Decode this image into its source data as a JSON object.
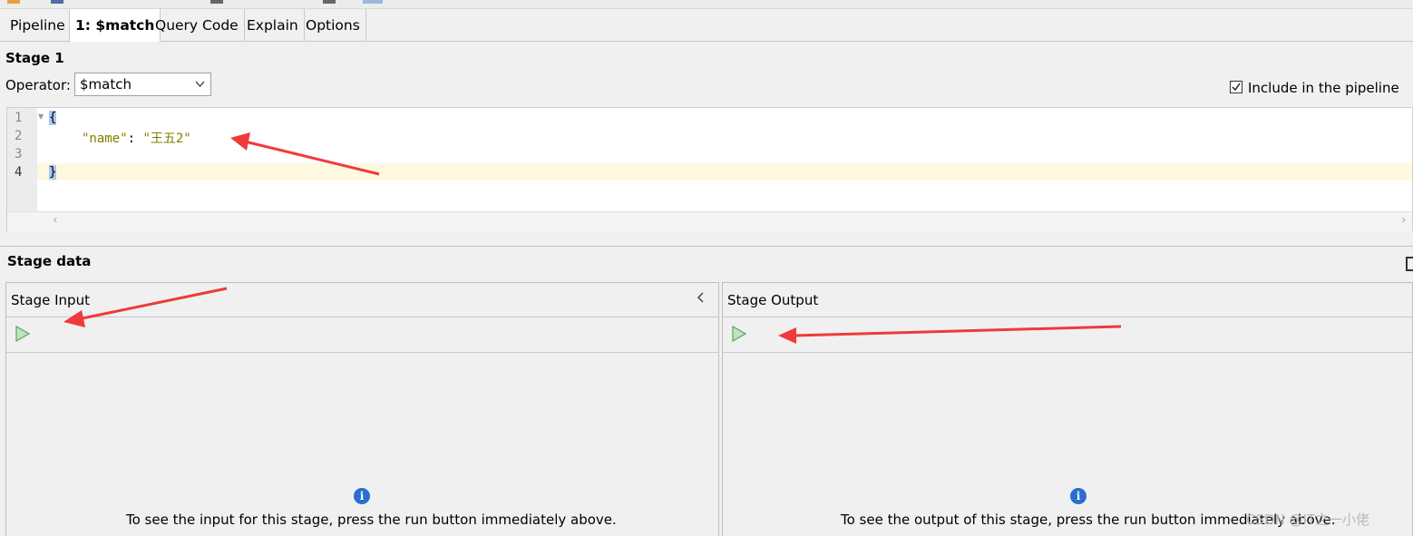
{
  "tabs": [
    "Pipeline",
    "1: $match",
    "Query Code",
    "Explain",
    "Options"
  ],
  "stage": {
    "title": "Stage 1",
    "operator_label": "Operator:",
    "operator_value": "$match",
    "include_label": "Include in the pipeline",
    "include_checked": true
  },
  "editor": {
    "line_numbers": [
      "1",
      "2",
      "3",
      "4"
    ],
    "open_brace": "{",
    "key": "\"name\"",
    "colon": ": ",
    "value": "\"王五2\"",
    "close_brace": "}"
  },
  "stage_data": {
    "title": "Stage data",
    "input_title": "Stage Input",
    "output_title": "Stage Output",
    "info_glyph": "i",
    "input_message": "To see the input for this stage, press the run button immediately above.",
    "output_message": "To see the output of this stage, press the run button immediately above."
  },
  "watermark": "CSDN @IT之一小佬",
  "icons": {
    "run": "play-icon",
    "info": "info-icon",
    "collapse": "chevron-left-icon",
    "dropdown": "chevron-down-icon",
    "checkbox": "checkmark-icon",
    "maximize": "maximize-icon",
    "annotation": "red-arrow"
  },
  "colors": {
    "play": "#7fc47f",
    "info": "#2a6fd0",
    "arrow": "#f03a3a",
    "json_key": "#808000",
    "current_line": "#fff8e0"
  }
}
